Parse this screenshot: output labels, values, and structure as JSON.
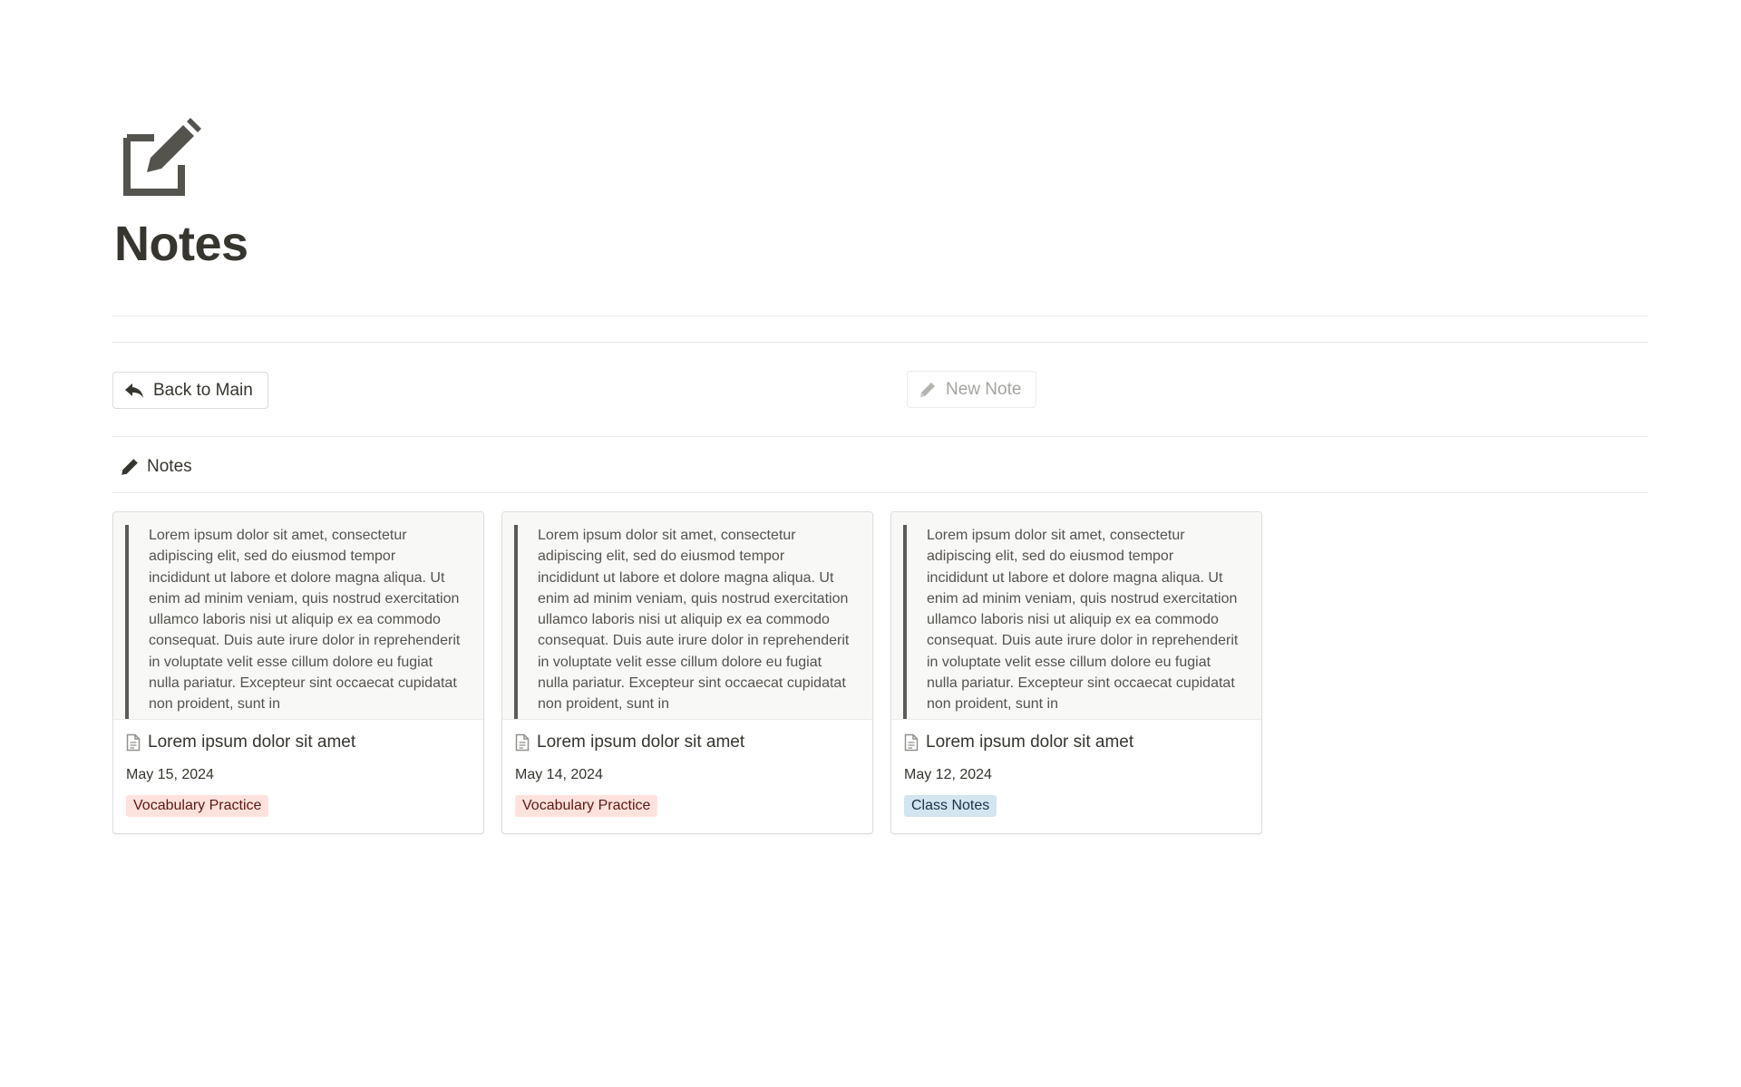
{
  "page": {
    "icon": "edit-square-icon",
    "title": "Notes"
  },
  "buttons": {
    "back_label": "Back to Main",
    "back_icon": "reply-arrow-icon",
    "new_note_label": "New Note",
    "new_note_icon": "pencil-icon"
  },
  "view": {
    "icon": "pencil-icon",
    "label": "Notes"
  },
  "cards": [
    {
      "preview": "Lorem ipsum dolor sit amet, consectetur adipiscing elit, sed do eiusmod tempor incididunt ut labore et dolore magna aliqua. Ut enim ad minim veniam, quis nostrud exercitation ullamco laboris nisi ut aliquip ex ea commodo consequat. Duis aute irure dolor in reprehenderit in voluptate velit esse cillum dolore eu fugiat nulla pariatur. Excepteur sint occaecat cupidatat non proident, sunt in",
      "title": "Lorem ipsum dolor sit amet",
      "date": "May 15, 2024",
      "tag": "Vocabulary Practice",
      "tag_bg": "#ffe2dd",
      "tag_color": "#5d1715"
    },
    {
      "preview": "Lorem ipsum dolor sit amet, consectetur adipiscing elit, sed do eiusmod tempor incididunt ut labore et dolore magna aliqua. Ut enim ad minim veniam, quis nostrud exercitation ullamco laboris nisi ut aliquip ex ea commodo consequat. Duis aute irure dolor in reprehenderit in voluptate velit esse cillum dolore eu fugiat nulla pariatur. Excepteur sint occaecat cupidatat non proident, sunt in",
      "title": "Lorem ipsum dolor sit amet",
      "date": "May 14, 2024",
      "tag": "Vocabulary Practice",
      "tag_bg": "#ffe2dd",
      "tag_color": "#5d1715"
    },
    {
      "preview": "Lorem ipsum dolor sit amet, consectetur adipiscing elit, sed do eiusmod tempor incididunt ut labore et dolore magna aliqua. Ut enim ad minim veniam, quis nostrud exercitation ullamco laboris nisi ut aliquip ex ea commodo consequat. Duis aute irure dolor in reprehenderit in voluptate velit esse cillum dolore eu fugiat nulla pariatur. Excepteur sint occaecat cupidatat non proident, sunt in",
      "title": "Lorem ipsum dolor sit amet",
      "date": "May 12, 2024",
      "tag": "Class Notes",
      "tag_bg": "#d3e5ef",
      "tag_color": "#183347"
    }
  ]
}
